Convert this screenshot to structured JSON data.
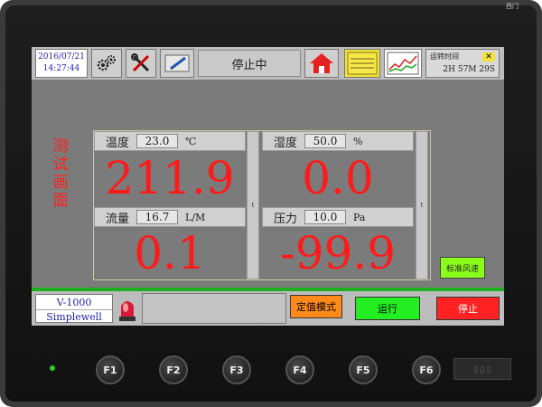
{
  "device": {
    "brand": "西门"
  },
  "topbar": {
    "date": "2016/07/21",
    "time": "14:27:44",
    "status": "停止中",
    "run_time_label": "运转时间",
    "run_time_value": "2H 57M 29S",
    "icons": [
      "gears-icon",
      "tools-icon",
      "pen-icon",
      "home-icon",
      "chart-lcd-icon",
      "trend-icon"
    ]
  },
  "side_title": "测试画面",
  "cells": {
    "temperature": {
      "label": "温度",
      "setpoint": "23.0",
      "unit": "℃",
      "value": "211.9"
    },
    "humidity": {
      "label": "湿度",
      "setpoint": "50.0",
      "unit": "%",
      "value": "0.0"
    },
    "flow": {
      "label": "流量",
      "setpoint": "16.7",
      "unit": "L/M",
      "value": "0.1"
    },
    "pressure": {
      "label": "压力",
      "setpoint": "10.0",
      "unit": "Pa",
      "value": "-99.9"
    }
  },
  "standard_wind_button": "标准风速",
  "model": {
    "name": "V-1000",
    "vendor": "Simplewell"
  },
  "buttons": {
    "fixed_mode": "定值模式",
    "run": "运行",
    "stop": "停止"
  },
  "fkeys": [
    "F1",
    "F2",
    "F3",
    "F4",
    "F5",
    "F6"
  ],
  "colors": {
    "value_red": "#ff1a1a",
    "run_green": "#22ee22",
    "stop_red": "#ff2222",
    "mode_orange": "#ff8a1a",
    "std_green": "#8aff1a"
  }
}
